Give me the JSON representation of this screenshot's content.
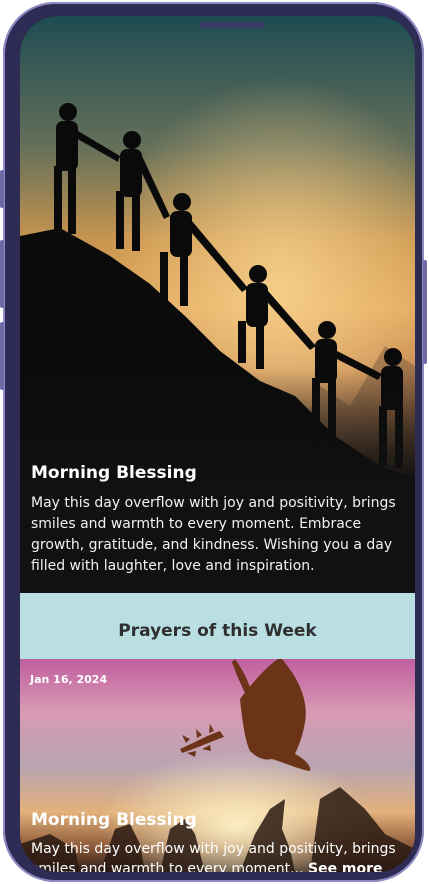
{
  "hero": {
    "title": "Morning Blessing",
    "text": "May this day overflow with joy and positivity, brings smiles and warmth to every moment. Embrace growth, gratitude, and kindness. Wishing you a day filled with laughter, love and inspiration."
  },
  "section": {
    "title": "Prayers of this Week"
  },
  "cards": [
    {
      "date": "Jan 16, 2024",
      "title": "Morning Blessing",
      "text": "May this day overflow with joy and positivity, brings smiles and warmth to every moment...",
      "see_more": "See more"
    }
  ],
  "colors": {
    "section_bg": "#b9dfe3",
    "frame": "#2e2b55",
    "screen_bg": "#111111"
  }
}
